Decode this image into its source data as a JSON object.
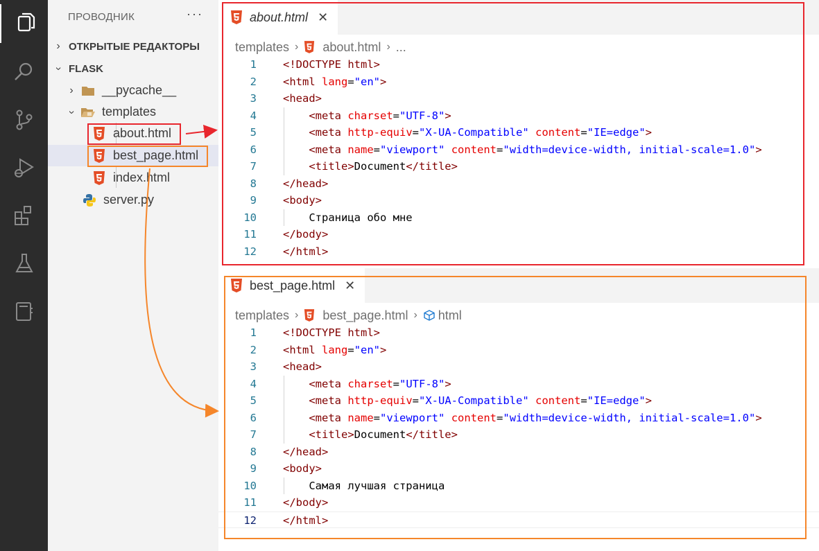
{
  "sidebar": {
    "title": "ПРОВОДНИК",
    "more": "···",
    "sections": [
      {
        "label": "ОТКРЫТЫЕ РЕДАКТОРЫ",
        "expanded": false
      },
      {
        "label": "FLASK",
        "expanded": true
      }
    ],
    "tree": [
      {
        "label": "__pycache__",
        "icon": "folder-icon"
      },
      {
        "label": "templates",
        "icon": "folder-open-icon"
      },
      {
        "label": "about.html",
        "icon": "html5-icon"
      },
      {
        "label": "best_page.html",
        "icon": "html5-icon"
      },
      {
        "label": "index.html",
        "icon": "html5-icon"
      },
      {
        "label": "server.py",
        "icon": "python-icon"
      }
    ]
  },
  "activity_bar": [
    "explorer-icon",
    "search-icon",
    "source-control-icon",
    "run-debug-icon",
    "extensions-icon",
    "testing-icon",
    "notebook-icon"
  ],
  "editors": [
    {
      "tab": {
        "label": "about.html",
        "close": "✕"
      },
      "breadcrumbs": [
        "templates",
        "about.html",
        "..."
      ],
      "code": {
        "line_numbers": [
          "1",
          "2",
          "3",
          "4",
          "5",
          "6",
          "7",
          "8",
          "9",
          "10",
          "11",
          "12"
        ],
        "body_text": "Страница обо мне"
      }
    },
    {
      "tab": {
        "label": "best_page.html",
        "close": "✕"
      },
      "breadcrumbs": [
        "templates",
        "best_page.html",
        "html"
      ],
      "code": {
        "line_numbers": [
          "1",
          "2",
          "3",
          "4",
          "5",
          "6",
          "7",
          "8",
          "9",
          "10",
          "11",
          "12"
        ],
        "body_text": "Самая лучшая страница"
      }
    }
  ],
  "html_lines": {
    "doctype": "<!DOCTYPE html>",
    "html_open": "<html",
    "lang_attr": "lang",
    "lang_val": "\"en\"",
    "head_open": "<head>",
    "meta": "<meta",
    "charset_attr": "charset",
    "charset_val": "\"UTF-8\"",
    "http_equiv_attr": "http-equiv",
    "http_equiv_val": "\"X-UA-Compatible\"",
    "content_attr": "content",
    "ie_edge_val": "\"IE=edge\"",
    "name_attr": "name",
    "viewport_val": "\"viewport\"",
    "viewport_content_val": "\"width=device-width, initial-scale=1.0\"",
    "title_open": "<title>",
    "title_text": "Document",
    "title_close": "</title>",
    "head_close": "</head>",
    "body_open": "<body>",
    "body_close": "</body>",
    "html_close": "</html>",
    "eq": "=",
    "gt": ">"
  },
  "colors": {
    "highlight_red": "#e8262d",
    "highlight_orange": "#f5862a"
  }
}
